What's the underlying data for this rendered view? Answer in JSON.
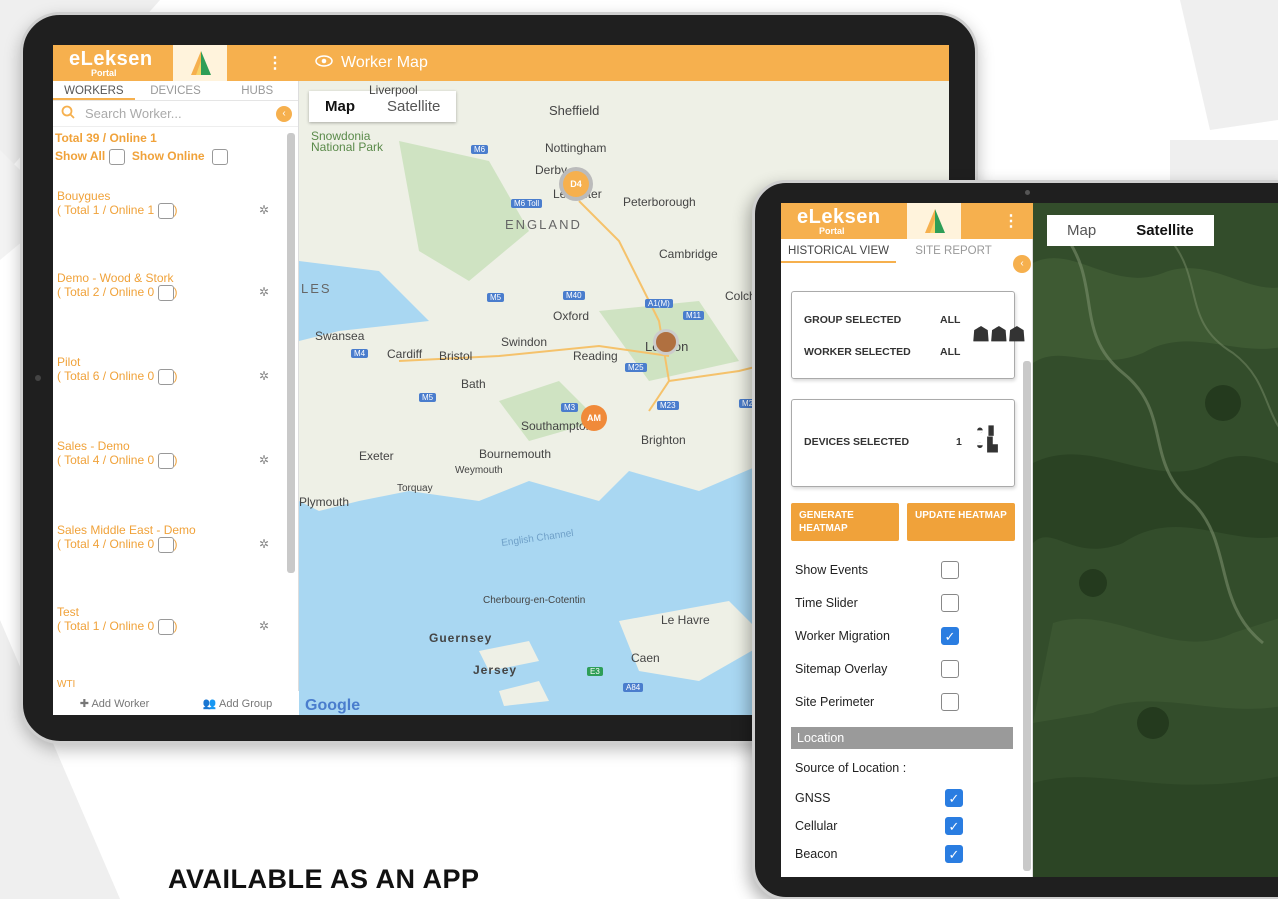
{
  "promo": {
    "headline": "AVAILABLE AS AN APP"
  },
  "app": {
    "logo_main": "eLeksen",
    "logo_sub": "Portal",
    "window_title": "Worker Map",
    "colors": {
      "accent": "#f6b04e",
      "accent_dark": "#f0a23a",
      "checkbox_on": "#2a7de1",
      "water": "#a9d7f2",
      "land": "#eef0e6"
    }
  },
  "sidebar": {
    "tabs": [
      "WORKERS",
      "DEVICES",
      "HUBS"
    ],
    "search_placeholder": "Search Worker...",
    "summary": "Total 39 / Online 1",
    "show_all": "Show All",
    "show_online": "Show Online",
    "groups": [
      {
        "name": "Bouygues",
        "counts": "( Total 1 / Online 1"
      },
      {
        "name": "Demo - Wood & Stork",
        "counts": "( Total 2 / Online 0"
      },
      {
        "name": "Pilot",
        "counts": "( Total 6 / Online 0"
      },
      {
        "name": "Sales - Demo",
        "counts": "( Total 4 / Online 0"
      },
      {
        "name": "Sales Middle East - Demo",
        "counts": "( Total 4 / Online 0"
      },
      {
        "name": "Test",
        "counts": "( Total 1 / Online 0"
      },
      {
        "name": "WTI",
        "counts": ""
      }
    ],
    "close_paren": ")",
    "add_worker": "Add Worker",
    "add_group": "Add Group"
  },
  "map": {
    "type_buttons": [
      "Map",
      "Satellite"
    ],
    "selected_type": "Map",
    "places": [
      "Liverpool",
      "Sheffield",
      "Snowdonia National Park",
      "Nottingham",
      "Derby",
      "Leicester",
      "Peterborough",
      "ENGLAND",
      "Cambridge",
      "LES",
      "Colchester",
      "Oxford",
      "Swansea",
      "Cardiff",
      "Bristol",
      "Swindon",
      "Reading",
      "London",
      "Bath",
      "Southampton",
      "Brighton",
      "Exeter",
      "Bournemouth",
      "Weymouth",
      "Torquay",
      "Plymouth",
      "English Channel",
      "Cherbourg-en-Cotentin",
      "Le Havre",
      "Guernsey",
      "Jersey",
      "Caen"
    ],
    "roads": [
      "M6",
      "M6 Toll",
      "M5",
      "M40",
      "A1(M)",
      "M11",
      "M4",
      "M25",
      "M5",
      "M23",
      "M3",
      "M2",
      "E3",
      "A84"
    ],
    "markers": [
      {
        "label": "D4"
      },
      {
        "label": "AM"
      },
      {
        "label": ""
      }
    ],
    "attribution": "Google"
  },
  "historical": {
    "tabs": [
      "HISTORICAL VIEW",
      "SITE REPORT"
    ],
    "group_selected_label": "GROUP SELECTED",
    "group_selected_value": "ALL",
    "worker_selected_label": "WORKER SELECTED",
    "worker_selected_value": "ALL",
    "devices_selected_label": "DEVICES SELECTED",
    "devices_selected_value": "1",
    "generate_label": "GENERATE HEATMAP",
    "update_label": "UPDATE HEATMAP",
    "options": [
      {
        "label": "Show Events",
        "checked": false
      },
      {
        "label": "Time Slider",
        "checked": false
      },
      {
        "label": "Worker Migration",
        "checked": true
      },
      {
        "label": "Sitemap Overlay",
        "checked": false
      },
      {
        "label": "Site Perimeter",
        "checked": false
      }
    ],
    "location_header": "Location",
    "source_label": "Source of Location :",
    "sources": [
      {
        "label": "GNSS",
        "checked": true
      },
      {
        "label": "Cellular",
        "checked": true
      },
      {
        "label": "Beacon",
        "checked": true
      }
    ]
  },
  "satellite_map": {
    "type_buttons": [
      "Map",
      "Satellite"
    ],
    "selected_type": "Satellite"
  }
}
